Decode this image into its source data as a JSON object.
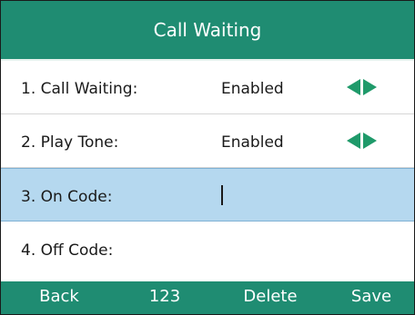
{
  "header": {
    "title": "Call Waiting"
  },
  "colors": {
    "accent": "#1f8c72",
    "selection": "#b5d8ef",
    "arrow": "#1f9a6a"
  },
  "rows": [
    {
      "label": "1. Call Waiting:",
      "value": "Enabled",
      "has_arrows": true
    },
    {
      "label": "2. Play Tone:",
      "value": "Enabled",
      "has_arrows": true
    },
    {
      "label": "3. On Code:",
      "value": "",
      "selected": true,
      "editing": true
    },
    {
      "label": "4. Off Code:",
      "value": ""
    }
  ],
  "softkeys": {
    "back": "Back",
    "input_mode": "123",
    "delete": "Delete",
    "save": "Save"
  }
}
